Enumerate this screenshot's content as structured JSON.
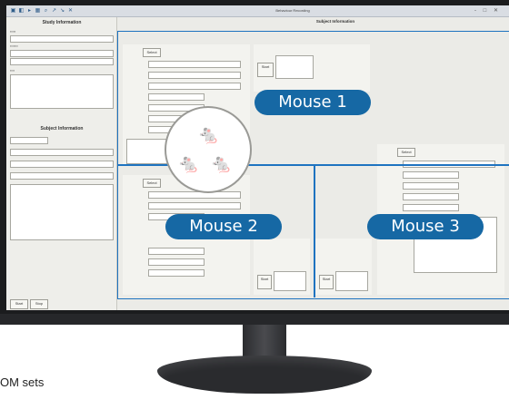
{
  "window": {
    "title": "Behaviour Recording",
    "toolbar_icons": [
      "open-icon",
      "save-icon",
      "play-icon",
      "grid-icon",
      "search-icon",
      "arrow-icon",
      "arrow-icon",
      "close-icon"
    ],
    "controls": "- □ ✕"
  },
  "left_panel": {
    "title": "Study Information",
    "lower_title": "Subject Information",
    "buttons": [
      "Start",
      "Stop"
    ]
  },
  "main": {
    "header": "Subject Information",
    "buttons": {
      "select": "Select",
      "start": "Start"
    }
  },
  "overlays": {
    "mouse1": "Mouse 1",
    "mouse2": "Mouse 2",
    "mouse3": "Mouse 3"
  },
  "caption": "OM sets",
  "colors": {
    "accent": "#1668a4",
    "frame": "#1e73c0"
  }
}
